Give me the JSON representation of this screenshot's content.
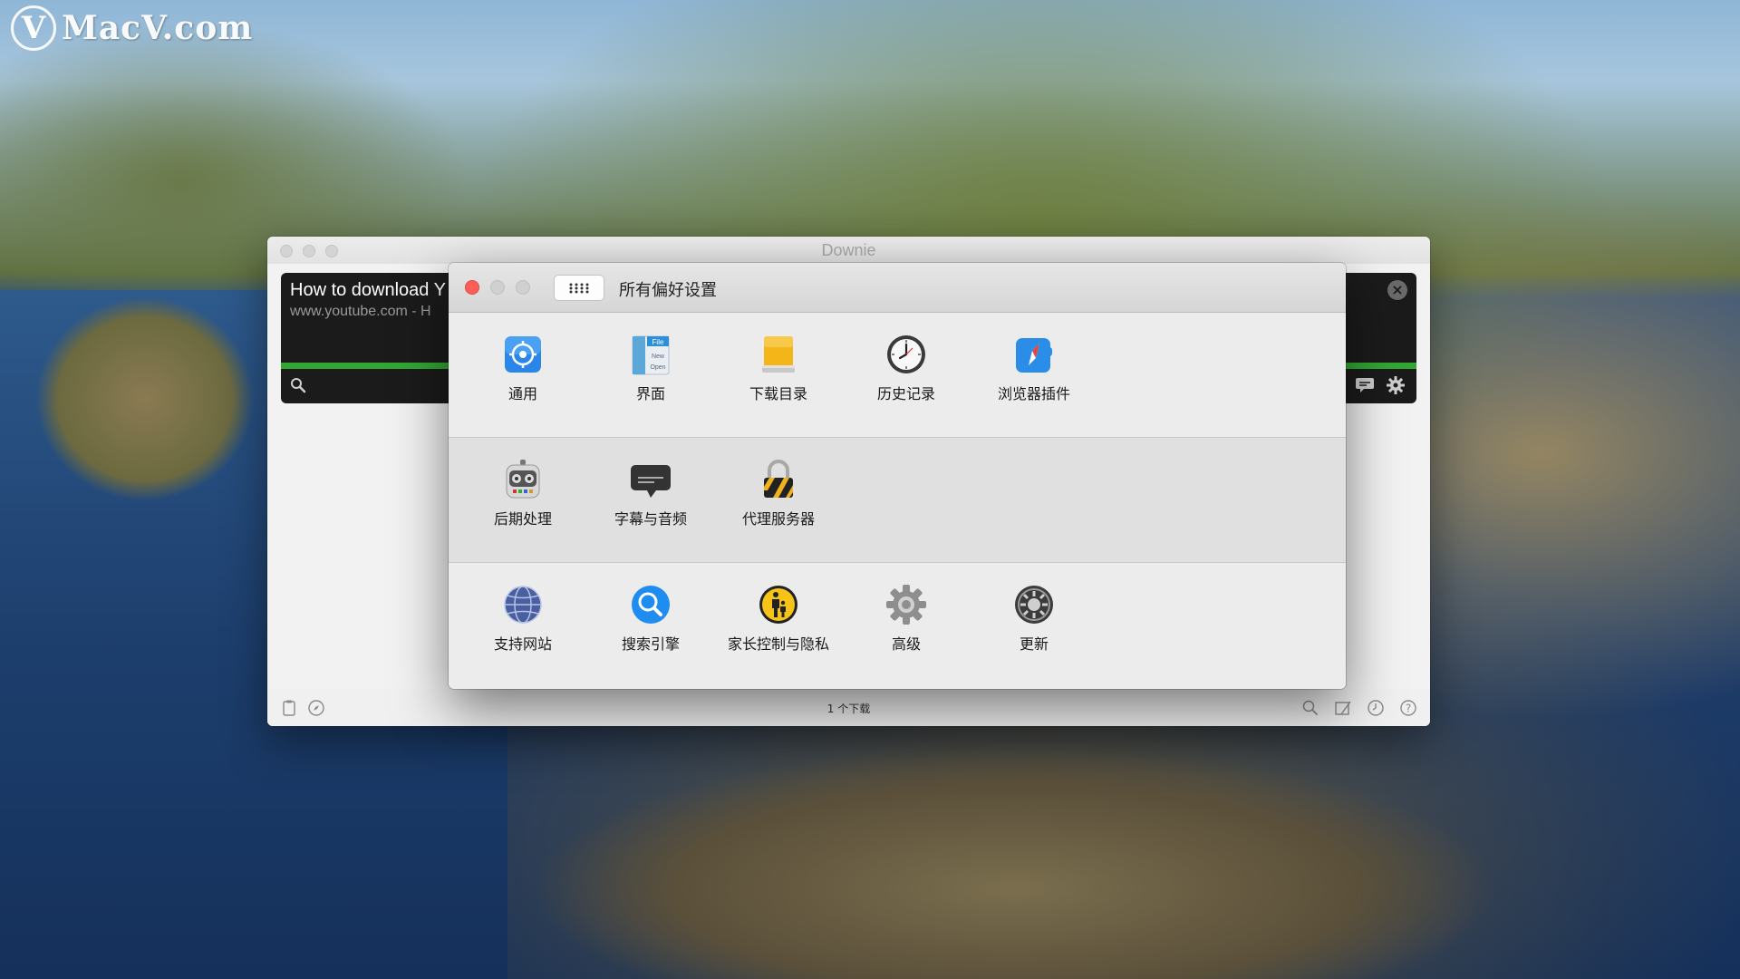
{
  "watermark": {
    "mark": "V",
    "text": "MacV.com"
  },
  "downie": {
    "title": "Downie",
    "download": {
      "title": "How to download Y",
      "subtitle": "www.youtube.com - H",
      "progress": 1.0
    },
    "footer": {
      "status": "1 个下载"
    }
  },
  "prefs": {
    "title": "所有偏好设置",
    "sections": [
      {
        "items": [
          {
            "label": "通用",
            "icon": "gear-app-icon"
          },
          {
            "label": "界面",
            "icon": "file-menu-icon"
          },
          {
            "label": "下载目录",
            "icon": "drive-icon"
          },
          {
            "label": "历史记录",
            "icon": "clock-icon"
          },
          {
            "label": "浏览器插件",
            "icon": "safari-compass-icon"
          }
        ]
      },
      {
        "items": [
          {
            "label": "后期处理",
            "icon": "robot-icon"
          },
          {
            "label": "字幕与音频",
            "icon": "subtitle-icon"
          },
          {
            "label": "代理服务器",
            "icon": "padlock-icon"
          }
        ]
      },
      {
        "items": [
          {
            "label": "支持网站",
            "icon": "globe-icon"
          },
          {
            "label": "搜索引擎",
            "icon": "search-icon"
          },
          {
            "label": "家长控制与隐私",
            "icon": "parental-control-icon"
          },
          {
            "label": "高级",
            "icon": "cog-icon"
          },
          {
            "label": "更新",
            "icon": "update-icon"
          }
        ]
      }
    ]
  },
  "colors": {
    "close": "#fc5f57",
    "progress": "#32a832",
    "accent": "#2a7de1"
  }
}
